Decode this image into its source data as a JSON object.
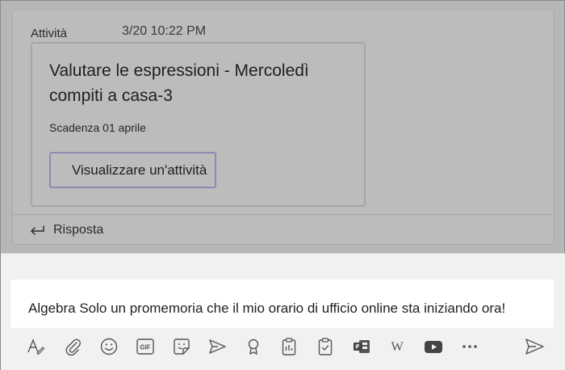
{
  "post": {
    "author": "Attività",
    "time": "3/20 10:22 PM",
    "assignment": {
      "title": "Valutare le espressioni - Mercoledì compiti a casa-3",
      "due": "Scadenza 01 aprile",
      "view_label": "Visualizzare un'attività"
    },
    "reply_label": "Risposta"
  },
  "compose": {
    "text": "Algebra Solo un promemoria che il mio orario di ufficio online sta iniziando ora!"
  },
  "toolbar": {
    "icons": [
      "format-icon",
      "attach-icon",
      "emoji-icon",
      "gif-icon",
      "sticker-icon",
      "meet-icon",
      "praise-icon",
      "clipboard-icon",
      "assignments-icon",
      "forms-icon",
      "wikipedia-icon",
      "youtube-icon",
      "more-icon",
      "send-icon"
    ],
    "gif_text": "GIF",
    "wiki_text": "W",
    "more_text": "•••"
  },
  "colors": {
    "overlay": "#b7b7b7",
    "accent": "#8e8bb3",
    "compose_bg": "#f2f1f0",
    "icon": "#555555"
  }
}
